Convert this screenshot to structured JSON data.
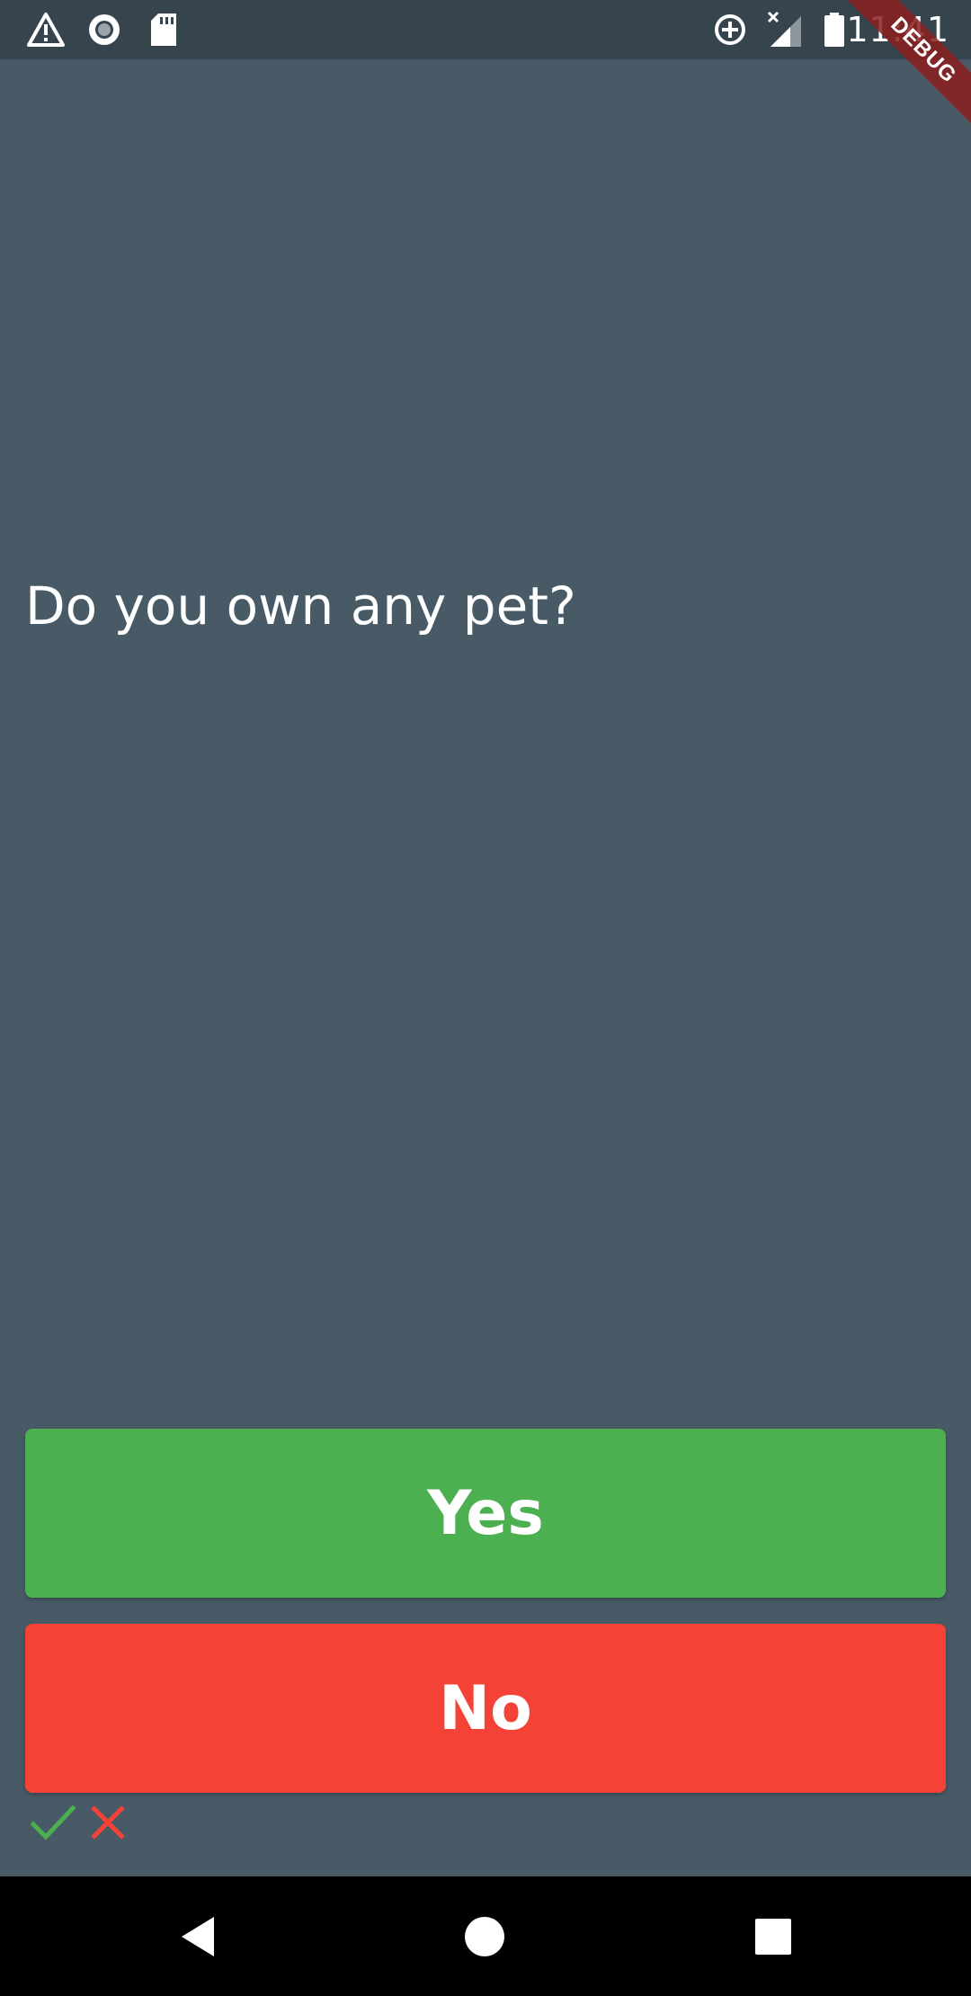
{
  "status_bar": {
    "time": "11:41",
    "icons": [
      "warning-icon",
      "sync-circle-icon",
      "sd-card-icon",
      "data-saver-icon",
      "signal-icon",
      "battery-icon"
    ]
  },
  "debug_banner": "DEBUG",
  "question": "Do you own any pet?",
  "buttons": {
    "yes_label": "Yes",
    "no_label": "No"
  },
  "colors": {
    "background": "#485a66",
    "status_bar": "#36444e",
    "yes": "#4caf50",
    "no": "#f44336",
    "check": "#4caf50",
    "cross": "#f44336"
  },
  "results": [
    "check-icon",
    "cross-icon"
  ],
  "nav_bar": {
    "buttons": [
      "back-icon",
      "home-icon",
      "recents-icon"
    ]
  }
}
